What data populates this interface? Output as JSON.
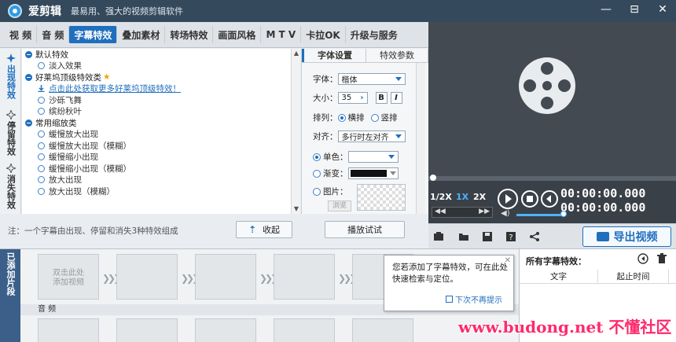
{
  "window": {
    "app_name": "爱剪辑",
    "tagline": "最易用、强大的视频剪辑软件",
    "controls": [
      "—",
      "⊟",
      "✕"
    ]
  },
  "tabs": [
    "视 频",
    "音 频",
    "字幕特效",
    "叠加素材",
    "转场特效",
    "画面风格",
    "M T V",
    "卡拉OK",
    "升级与服务"
  ],
  "active_tab": "字幕特效",
  "categories": [
    "出现特效",
    "停留特效",
    "消失特效"
  ],
  "tree": {
    "groups": [
      {
        "label": "默认特效",
        "items": [
          "淡入效果"
        ]
      },
      {
        "label": "好莱坞顶级特效类",
        "star": "★",
        "link": "点击此处获取更多好莱坞顶级特效！",
        "items": [
          "沙砾飞舞",
          "缤纷秋叶"
        ]
      },
      {
        "label": "常用缩放类",
        "items": [
          "缓慢放大出现",
          "缓慢放大出现（模糊）",
          "缓慢缩小出现",
          "缓慢缩小出现（模糊）",
          "放大出现",
          "放大出现（模糊）"
        ]
      }
    ]
  },
  "note": "注：一个字幕由出现、停留和消失3种特效组成",
  "collapse_button": "收起",
  "font_panel": {
    "tabs": [
      "字体设置",
      "特效参数"
    ],
    "font_label": "字体：",
    "font_value": "楷体",
    "size_label": "大小：",
    "size_value": "35",
    "bold": "B",
    "italic": "I",
    "layout_label": "排列：",
    "layout_options": [
      "横排",
      "竖排"
    ],
    "align_label": "对齐：",
    "align_value": "多行时左对齐",
    "color_single": "单色：",
    "color_gradient": "渐变：",
    "color_image": "图片：",
    "browse": "浏览"
  },
  "preview_button": "播放试试",
  "player": {
    "speeds": [
      "1/2X",
      "1X",
      "2X"
    ],
    "active_speed": "1X",
    "current_time": "00:00:00.000",
    "total_time": "00:00:00.000",
    "volume_percent": 90
  },
  "export_button": "导出视频",
  "timeline": {
    "label": "已添加片段",
    "first_clip": "双击此处\n添加视频",
    "audio_label": "音 频"
  },
  "tooltip": {
    "text": "您若添加了字幕特效，可在此处快速检索与定位。",
    "checkbox": "下次不再提示"
  },
  "fx_list": {
    "title": "所有字幕特效：",
    "col_text": "文字",
    "col_time": "起止时间"
  },
  "watermark": "www.budong.net 不懂社区",
  "colors": {
    "accent": "#1f6fbd",
    "titlebar": "#34495c",
    "player": "#444a52"
  }
}
